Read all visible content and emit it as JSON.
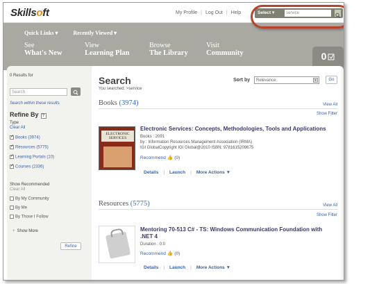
{
  "app": {
    "logo": {
      "pre": "Skills",
      "o": "o",
      "post": "ft"
    }
  },
  "header": {
    "links": [
      "My Profile",
      "Log Out",
      "Help"
    ],
    "search": {
      "select_label": "Select ▾",
      "query": "service"
    }
  },
  "nav": {
    "quick_links": "Quick Links ▾",
    "recently_viewed": "Recently Viewed ▾",
    "items": [
      {
        "l1": "See",
        "l2": "What's New"
      },
      {
        "l1": "View",
        "l2": "Learning Plan"
      },
      {
        "l1": "Browse",
        "l2": "The Library"
      },
      {
        "l1": "Visit",
        "l2": "Community"
      }
    ],
    "cart_count": "0"
  },
  "sidebar": {
    "results": "0 Results for",
    "search_placeholder": "Search",
    "within": "Search within these results",
    "refine_by": "Refine By",
    "help_icon": "?",
    "type_label": "Type",
    "clear_all": "Clear All",
    "types": [
      {
        "label": "Books (3974)",
        "checked": true
      },
      {
        "label": "Resources (5775)",
        "checked": true
      },
      {
        "label": "Learning Portals (10)",
        "checked": true
      },
      {
        "label": "Courses (2336)",
        "checked": true
      }
    ],
    "show_recommended": "Show Recommended",
    "clear_all_2": "Clear All",
    "recommended": [
      {
        "label": "By My Community"
      },
      {
        "label": "By Me"
      },
      {
        "label": "By Those I Follow"
      }
    ],
    "show_more": "Show More",
    "refine_button": "Refine"
  },
  "main": {
    "title": "Search",
    "searched": "You searched: >service",
    "sort_by": "Sort by",
    "sort_value": "Relevance",
    "go": "Go",
    "sections": [
      {
        "name": "Books",
        "count": "(3974)",
        "view_all": "View All",
        "show_filter": "Show Filter",
        "result": {
          "cover_title": "ELECTRONIC SERVICES",
          "title": "Electronic Services: Concepts, Methodologies, Tools and Applications",
          "line1": "Books : 2091",
          "line2": "by : Information Resources Management Association (IRMA)",
          "line3": "IGI GlobalCopyright IGI Global@2010 ISBN: 9781615209675",
          "recommend": "Recommend",
          "recommend_count": "(0)"
        }
      },
      {
        "name": "Resources",
        "count": "(5775)",
        "view_all": "View All",
        "show_filter": "Show Filter",
        "result": {
          "title": "Mentoring 70-513 C# - TS: Windows Communication Foundation with .NET 4",
          "line1": "Duration : 0:0",
          "recommend": "Recommend",
          "recommend_count": "(0)"
        }
      }
    ],
    "actions": {
      "details": "Details",
      "launch": "Launch",
      "more": "More Actions ▼"
    }
  },
  "colors": {
    "nav_band": "#a9a9a2",
    "highlight": "#b8432d",
    "link": "#3a5fa6"
  }
}
